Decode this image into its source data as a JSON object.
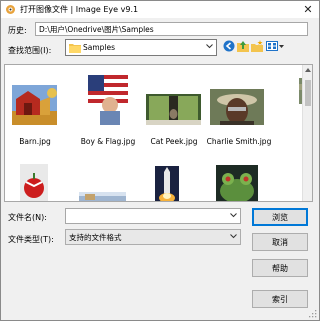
{
  "window": {
    "title": "打开图像文件 | Image Eye v9.1",
    "close_glyph": "✕"
  },
  "history": {
    "label": "历史:",
    "value": "D:\\用户\\Onedrive\\图片\\Samples"
  },
  "look_in": {
    "label": "查找范围(I):",
    "value": "Samples"
  },
  "toolbar": {
    "icons": [
      "back-icon",
      "up-folder-icon",
      "new-folder-icon",
      "view-menu-icon"
    ]
  },
  "files": [
    {
      "name": "Barn.jpg"
    },
    {
      "name": "Boy & Flag.jpg"
    },
    {
      "name": "Cat Peek.jpg"
    },
    {
      "name": "Charlie Smith.jpg"
    },
    {
      "name": ""
    },
    {
      "name": ""
    },
    {
      "name": ""
    },
    {
      "name": ""
    }
  ],
  "filename": {
    "label": "文件名(N):",
    "value": ""
  },
  "filetype": {
    "label": "文件类型(T):",
    "value": "支持的文件格式"
  },
  "buttons": {
    "open": "浏览",
    "cancel": "取消",
    "help": "帮助",
    "index": "索引"
  },
  "colors": {
    "accent": "#0078d7",
    "dialog_bg": "#f0f0f0"
  }
}
